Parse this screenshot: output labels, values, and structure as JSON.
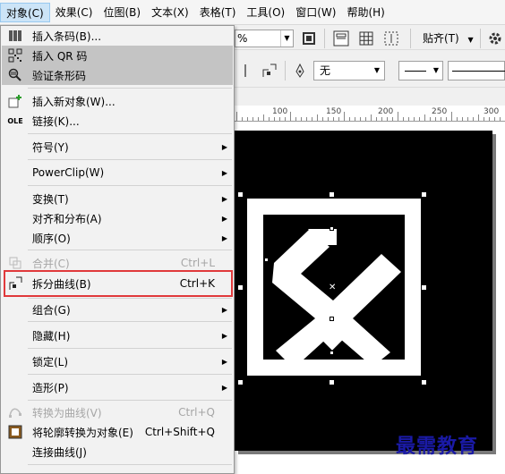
{
  "menubar": {
    "items": [
      {
        "label": "对象(C)",
        "active": true
      },
      {
        "label": "效果(C)"
      },
      {
        "label": "位图(B)"
      },
      {
        "label": "文本(X)"
      },
      {
        "label": "表格(T)"
      },
      {
        "label": "工具(O)"
      },
      {
        "label": "窗口(W)"
      },
      {
        "label": "帮助(H)"
      }
    ]
  },
  "toolbar": {
    "zoom_value": "%",
    "snap_label": "贴齐(T)",
    "outline_value": "无"
  },
  "ruler": {
    "labels": [
      "100",
      "150",
      "200",
      "250",
      "300"
    ]
  },
  "watermark": "最需教育",
  "menu": {
    "items": [
      {
        "label": "插入条码(B)...",
        "icon": "barcode-icon"
      },
      {
        "label": "插入 QR 码",
        "icon": "qr-code-icon"
      },
      {
        "label": "验证条形码",
        "icon": "verify-barcode-icon"
      },
      {
        "label": "插入新对象(W)...",
        "icon": "insert-object-icon"
      },
      {
        "label": "链接(K)...",
        "icon": "ole-link-icon"
      },
      {
        "label": "符号(Y)"
      },
      {
        "label": "PowerClip(W)"
      },
      {
        "label": "变换(T)"
      },
      {
        "label": "对齐和分布(A)"
      },
      {
        "label": "顺序(O)"
      },
      {
        "label": "合并(C)",
        "shortcut": "Ctrl+L",
        "disabled": true
      },
      {
        "label": "拆分曲线(B)",
        "shortcut": "Ctrl+K",
        "icon": "break-apart-icon"
      },
      {
        "label": "组合(G)"
      },
      {
        "label": "隐藏(H)"
      },
      {
        "label": "锁定(L)"
      },
      {
        "label": "造形(P)"
      },
      {
        "label": "转换为曲线(V)",
        "shortcut": "Ctrl+Q",
        "disabled": true
      },
      {
        "label": "将轮廓转换为对象(E)",
        "shortcut": "Ctrl+Shift+Q"
      },
      {
        "label": "连接曲线(J)"
      }
    ]
  }
}
